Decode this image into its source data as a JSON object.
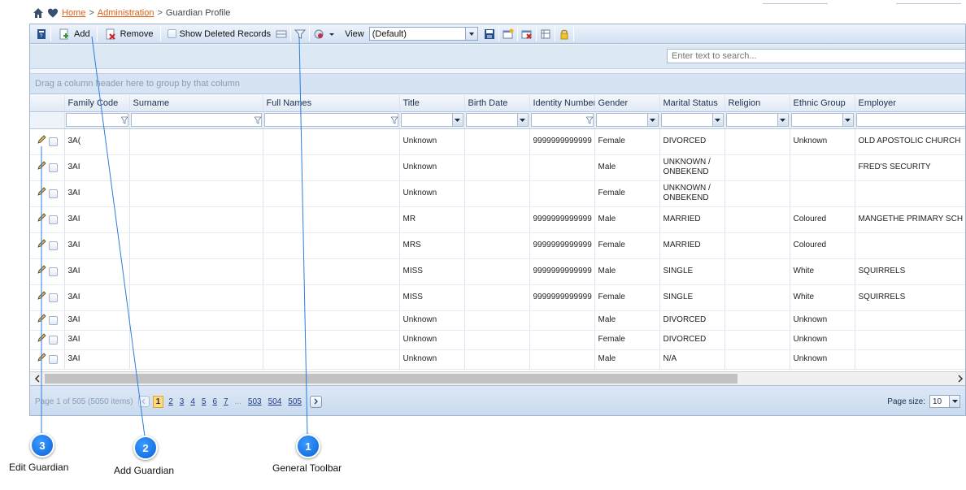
{
  "breadcrumb": {
    "home": "Home",
    "sep1": ">",
    "admin": "Administration",
    "sep2": ">",
    "current": "Guardian Profile"
  },
  "toolbar": {
    "add": "Add",
    "remove": "Remove",
    "show_deleted": "Show Deleted Records",
    "view_label": "View",
    "view_value": "(Default)"
  },
  "search": {
    "placeholder": "Enter text to search..."
  },
  "group_hint": "Drag a column header here to group by that column",
  "columns": {
    "family_code": "Family Code",
    "surname": "Surname",
    "full_names": "Full Names",
    "title": "Title",
    "birth_date": "Birth Date",
    "identity_number": "Identity Number",
    "gender": "Gender",
    "marital_status": "Marital Status",
    "religion": "Religion",
    "ethnic_group": "Ethnic Group",
    "employer": "Employer"
  },
  "rows": [
    {
      "code": "3A(",
      "title": "Unknown",
      "id": "9999999999999",
      "gender": "Female",
      "marital": "DIVORCED",
      "ethnic": "Unknown",
      "employer": "OLD APOSTOLIC CHURCH"
    },
    {
      "code": "3AI",
      "title": "Unknown",
      "id": "",
      "gender": "Male",
      "marital": "UNKNOWN / ONBEKEND",
      "ethnic": "",
      "employer": "FRED'S SECURITY"
    },
    {
      "code": "3AI",
      "title": "Unknown",
      "id": "",
      "gender": "Female",
      "marital": "UNKNOWN / ONBEKEND",
      "ethnic": "",
      "employer": ""
    },
    {
      "code": "3AI",
      "title": "MR",
      "id": "9999999999999",
      "gender": "Male",
      "marital": "MARRIED",
      "ethnic": "Coloured",
      "employer": "MANGETHE PRIMARY SCH"
    },
    {
      "code": "3AI",
      "title": "MRS",
      "id": "9999999999999",
      "gender": "Female",
      "marital": "MARRIED",
      "ethnic": "Coloured",
      "employer": ""
    },
    {
      "code": "3AI",
      "title": "MISS",
      "id": "9999999999999",
      "gender": "Male",
      "marital": "SINGLE",
      "ethnic": "White",
      "employer": "SQUIRRELS"
    },
    {
      "code": "3AI",
      "title": "MISS",
      "id": "9999999999999",
      "gender": "Female",
      "marital": "SINGLE",
      "ethnic": "White",
      "employer": "SQUIRRELS"
    },
    {
      "code": "3AI",
      "title": "Unknown",
      "id": "",
      "gender": "Male",
      "marital": "DIVORCED",
      "ethnic": "Unknown",
      "employer": ""
    },
    {
      "code": "3AI",
      "title": "Unknown",
      "id": "",
      "gender": "Female",
      "marital": "DIVORCED",
      "ethnic": "Unknown",
      "employer": ""
    },
    {
      "code": "3AI",
      "title": "Unknown",
      "id": "",
      "gender": "Male",
      "marital": "N/A",
      "ethnic": "Unknown",
      "employer": ""
    }
  ],
  "pager": {
    "info": "Page 1 of 505 (5050 items)",
    "current": "1",
    "pages": [
      "2",
      "3",
      "4",
      "5",
      "6",
      "7"
    ],
    "dots": "...",
    "last_pages": [
      "503",
      "504",
      "505"
    ],
    "page_size_label": "Page size:",
    "page_size": "10"
  },
  "callouts": [
    {
      "num": "3",
      "label": "Edit Guardian"
    },
    {
      "num": "2",
      "label": "Add Guardian"
    },
    {
      "num": "1",
      "label": "General Toolbar"
    }
  ],
  "colors": {
    "accent": "#0a63d8",
    "link": "#e06010",
    "header_bg": "#d2e1f2"
  }
}
